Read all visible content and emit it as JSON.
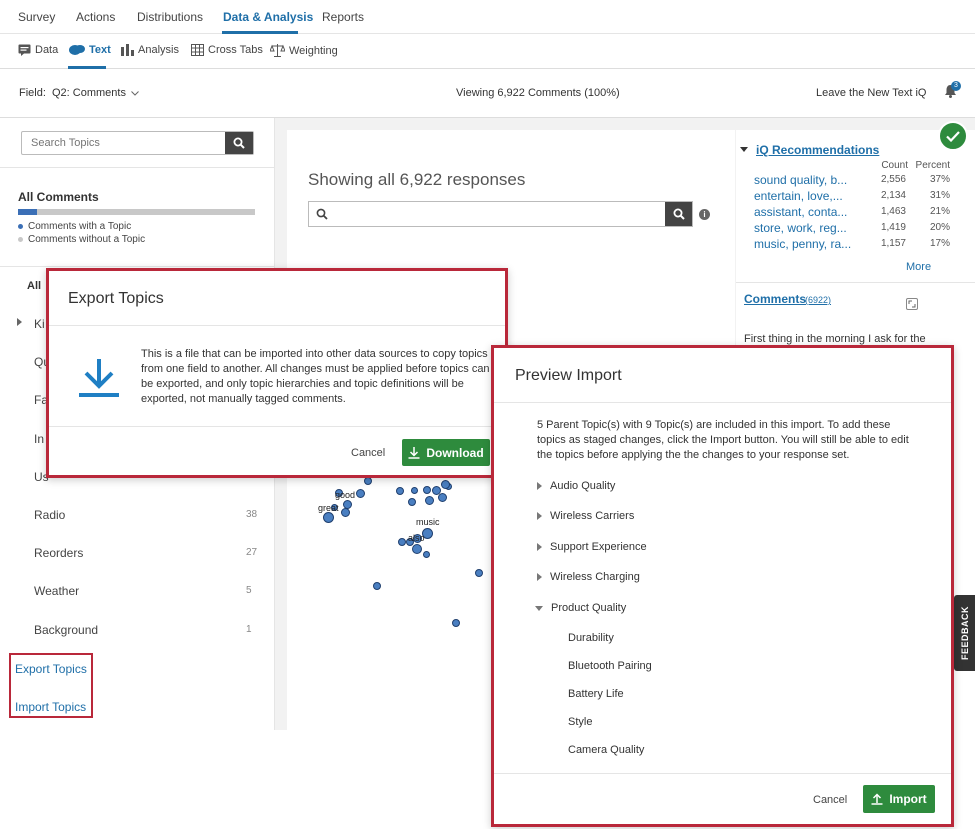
{
  "top_nav": {
    "items": [
      "Survey",
      "Actions",
      "Distributions",
      "Data & Analysis",
      "Reports"
    ]
  },
  "sub_nav": {
    "items": [
      "Data",
      "Text",
      "Analysis",
      "Cross Tabs",
      "Weighting"
    ]
  },
  "field_bar": {
    "label": "Field:",
    "value": "Q2: Comments",
    "viewing": "Viewing 6,922 Comments (100%)",
    "leave": "Leave the New Text iQ",
    "notif_count": "3"
  },
  "left": {
    "search_placeholder": "Search Topics",
    "all_comments": "All Comments",
    "legend_with": "Comments with a Topic",
    "legend_without": "Comments without a Topic",
    "all_label": "All",
    "obscured_letters": [
      "Ki",
      "Qu",
      "Fa",
      "In",
      "Us"
    ],
    "topics": [
      {
        "name": "Radio",
        "count": "38"
      },
      {
        "name": "Reorders",
        "count": "27"
      },
      {
        "name": "Weather",
        "count": "5"
      },
      {
        "name": "Background",
        "count": "1"
      }
    ],
    "export_link": "Export Topics",
    "import_link": "Import Topics"
  },
  "center": {
    "heading": "Showing all 6,922 responses",
    "bubble_labels": [
      "good",
      "great",
      "music",
      "also"
    ]
  },
  "right": {
    "recs_title": "iQ Recommendations",
    "count_header": "Count",
    "percent_header": "Percent",
    "recs": [
      {
        "label": "sound quality, b...",
        "count": "2,556",
        "percent": "37%"
      },
      {
        "label": "entertain, love,...",
        "count": "2,134",
        "percent": "31%"
      },
      {
        "label": "assistant, conta...",
        "count": "1,463",
        "percent": "21%"
      },
      {
        "label": "store, work, reg...",
        "count": "1,419",
        "percent": "20%"
      },
      {
        "label": "music, penny, ra...",
        "count": "1,157",
        "percent": "17%"
      }
    ],
    "more": "More",
    "comments_title": "Comments",
    "comments_count": "(6922)",
    "comment_text": "First thing in the morning I ask for the"
  },
  "export_modal": {
    "title": "Export Topics",
    "body": "This is a file that can be imported into other data sources to copy topics from one field to another. All changes must be applied before topics can be exported, and only topic hierarchies and topic definitions will be exported, not manually tagged comments.",
    "cancel": "Cancel",
    "download": "Download"
  },
  "preview_modal": {
    "title": "Preview Import",
    "body": "5 Parent Topic(s) with 9 Topic(s) are included in this import. To add these topics as staged changes, click the Import button. You will still be able to edit the topics before applying the the changes to your response set.",
    "parents": [
      "Audio Quality",
      "Wireless Carriers",
      "Support Experience",
      "Wireless Charging",
      "Product Quality"
    ],
    "children": [
      "Durability",
      "Bluetooth Pairing",
      "Battery Life",
      "Style",
      "Camera Quality"
    ],
    "cancel": "Cancel",
    "import": "Import"
  },
  "feedback_tab": "FEEDBACK",
  "colors": {
    "accent": "#1f6fa8",
    "highlight_border": "#b9283a",
    "green": "#2e8b3d"
  }
}
